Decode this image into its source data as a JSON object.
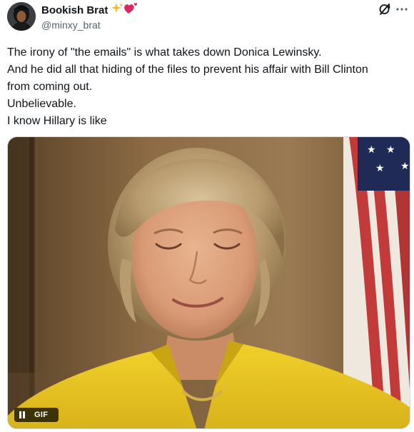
{
  "author": {
    "display_name": "Bookish Brat",
    "handle": "@minxy_brat",
    "emoji_icons": [
      "sparkles-icon",
      "heart-icon"
    ]
  },
  "tweet": {
    "lines": [
      "The irony of \"the emails\" is what takes down Donica Lewinsky.",
      "And he did all that hiding of the files to prevent his affair with Bill Clinton",
      "from coming out.",
      "Unbelievable.",
      "I know Hillary is like"
    ]
  },
  "media": {
    "type": "gif",
    "badge_label": "GIF",
    "pause_icon": "pause-icon"
  },
  "colors": {
    "text": "#0f1419",
    "secondary": "#536471",
    "border": "#cfd9de",
    "blazer": "#e6c21f",
    "flag_red": "#c23a3a"
  }
}
